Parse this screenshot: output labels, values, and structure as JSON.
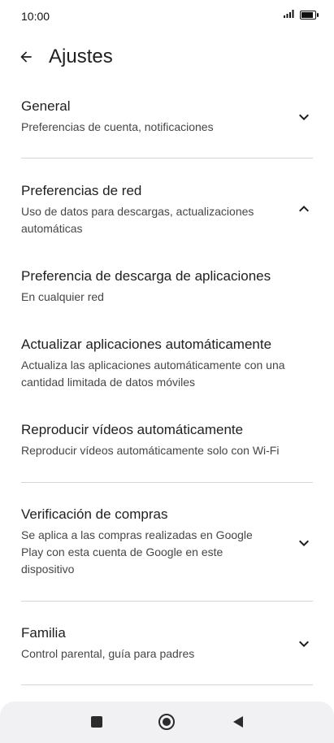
{
  "status": {
    "time": "10:00"
  },
  "header": {
    "title": "Ajustes"
  },
  "sections": [
    {
      "title": "General",
      "subtitle": "Preferencias de cuenta, notificaciones"
    },
    {
      "title": "Preferencias de red",
      "subtitle": "Uso de datos para descargas, actualizaciones automáticas"
    },
    {
      "title": "Preferencia de descarga de aplicaciones",
      "subtitle": "En cualquier red"
    },
    {
      "title": "Actualizar aplicaciones automáticamente",
      "subtitle": "Actualiza las aplicaciones automáticamente con una cantidad limitada de datos móviles"
    },
    {
      "title": "Reproducir vídeos automáticamente",
      "subtitle": "Reproducir vídeos automáticamente solo con Wi-Fi"
    },
    {
      "title": "Verificación de compras",
      "subtitle": "Se aplica a las compras realizadas en Google Play con esta cuenta de Google en este dispositivo"
    },
    {
      "title": "Familia",
      "subtitle": "Control parental, guía para padres"
    }
  ],
  "icons": {
    "back": "arrow-back-icon",
    "expand": "chevron-down-icon",
    "collapse": "chevron-up-icon",
    "nav_recents": "square-icon",
    "nav_home": "circle-icon",
    "nav_back": "triangle-back-icon"
  },
  "colors": {
    "text": "#1f1f1f",
    "subtext": "#444746",
    "divider": "#d4d4d4",
    "navbar": "#f1f1f3"
  }
}
